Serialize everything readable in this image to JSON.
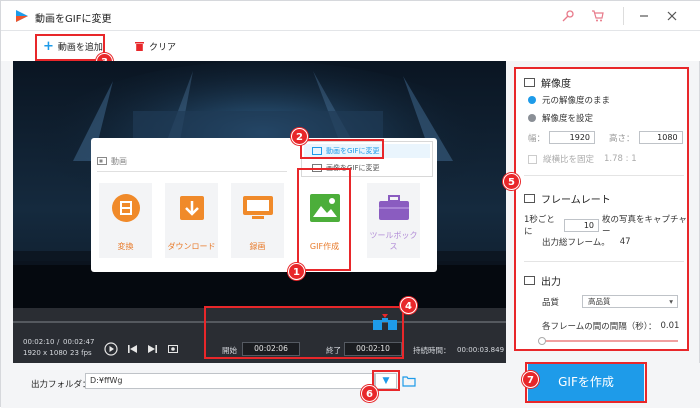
{
  "window": {
    "title": "動画をGIFに変更"
  },
  "toolbar": {
    "add_video": "動画を追加",
    "clear": "クリア"
  },
  "menu": {
    "section_label": "動画",
    "popup_item_1": "動画をGIFに変更",
    "popup_item_2": "画像をGIFに変更",
    "tiles": [
      "変換",
      "ダウンロード",
      "録画",
      "GIF作成",
      "ツールボックス"
    ]
  },
  "player": {
    "time_current": "00:02:10",
    "time_sep": "/",
    "time_total": "00:02:47",
    "resolution": "1920 x 1080",
    "fps": "23 fps",
    "start_label": "開始",
    "start_value": "00:02:06",
    "end_label": "終了",
    "end_value": "00:02:10",
    "duration_label": "持続時間：",
    "duration_value": "00:00:03.849"
  },
  "settings": {
    "resolution_title": "解像度",
    "option_keep": "元の解像度のまま",
    "option_set": "解像度を設定",
    "width_label": "幅：",
    "width_value": "1920",
    "height_label": "高さ：",
    "height_value": "1080",
    "aspect_label": "縦横比を固定",
    "aspect_value": "1.78 : 1",
    "framerate_title": "フレームレート",
    "per_second_label": "1秒ごとに",
    "per_second_value": "10",
    "per_second_suffix": "枚の写真をキャプチャー",
    "output_frames_label": "出力総フレーム。",
    "output_frames_value": "47",
    "output_title": "出力",
    "quality_label": "品質",
    "quality_value": "高品質",
    "interval_label": "各フレームの間の間隔（秒）：",
    "interval_value": "0.01"
  },
  "bottom": {
    "folder_label": "出力フォルダ：",
    "folder_value": "D:¥ffWg",
    "create_button": "GIFを作成"
  },
  "badges": [
    "1",
    "2",
    "3",
    "4",
    "5",
    "6",
    "7"
  ],
  "colors": {
    "accent": "#1e9be9",
    "highlight": "#e8272a",
    "tile_orange": "#f08a2a",
    "gif_green": "#4cae3a",
    "toolbox_purple": "#8a5cc0"
  }
}
